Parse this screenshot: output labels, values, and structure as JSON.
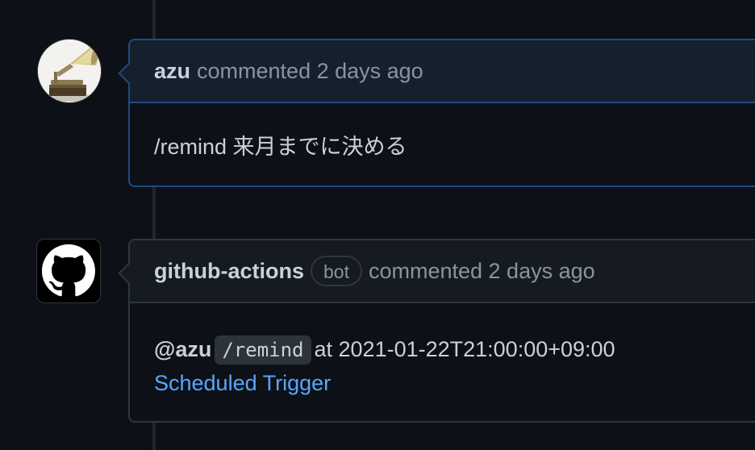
{
  "comments": [
    {
      "author": "azu",
      "action": "commented 2 days ago",
      "body": "/remind 来月までに決める",
      "avatar_icon": "gramophone-avatar-icon"
    },
    {
      "author": "github-actions",
      "badge": "bot",
      "action": "commented 2 days ago",
      "mention": "@azu",
      "command": "/remind",
      "at_text": "at 2021-01-22T21:00:00+09:00",
      "link_text": "Scheduled Trigger",
      "avatar_icon": "github-octocat-icon"
    }
  ],
  "colors": {
    "background": "#0d1117",
    "highlight_border": "#1f4a84",
    "border": "#30363d",
    "link": "#58a6ff",
    "text": "#c9d1d9",
    "muted": "#8b949e"
  }
}
